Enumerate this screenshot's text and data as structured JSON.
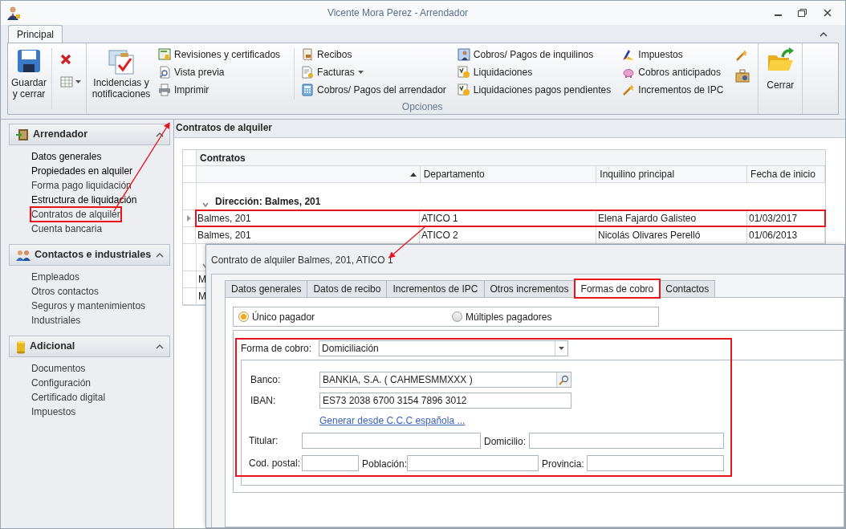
{
  "window": {
    "title": "Vicente Mora Perez - Arrendador"
  },
  "ribbon": {
    "tabs": [
      {
        "label": "Principal",
        "selected": true
      }
    ],
    "save": {
      "label": "Guardar y cerrar"
    },
    "options": {
      "title": "Opciones",
      "large": {
        "label": "Incidencias y notificaciones"
      },
      "columns": [
        [
          {
            "label": "Revisiones y certificados",
            "dropdown": false
          },
          {
            "label": "Vista previa",
            "dropdown": false
          },
          {
            "label": "Imprimir",
            "dropdown": false
          }
        ],
        [
          {
            "label": "Recibos",
            "dropdown": false
          },
          {
            "label": "Facturas",
            "dropdown": true
          },
          {
            "label": "Cobros/ Pagos del arrendador",
            "dropdown": false
          }
        ],
        [
          {
            "label": "Cobros/ Pagos de inquilinos",
            "dropdown": false
          },
          {
            "label": "Liquidaciones",
            "dropdown": false
          },
          {
            "label": "Liquidaciones pagos pendientes",
            "dropdown": false
          }
        ],
        [
          {
            "label": "Impuestos",
            "dropdown": false
          },
          {
            "label": "Cobros anticipados",
            "dropdown": false
          },
          {
            "label": "Incrementos de IPC",
            "dropdown": false
          }
        ]
      ]
    },
    "close": {
      "label": "Cerrar"
    }
  },
  "sidebar": {
    "sections": [
      {
        "title": "Arrendador",
        "expanded": true,
        "items": [
          {
            "label": "Datos generales",
            "disabled": false,
            "highlighted": false
          },
          {
            "label": "Propiedades en alquiler",
            "disabled": false,
            "highlighted": false
          },
          {
            "label": "Forma pago liquidación",
            "disabled": true,
            "highlighted": false
          },
          {
            "label": "Estructura de liquidación",
            "disabled": false,
            "highlighted": false
          },
          {
            "label": "Contratos de alquiler",
            "disabled": true,
            "highlighted": true
          },
          {
            "label": "Cuenta bancaria",
            "disabled": true,
            "highlighted": false
          }
        ]
      },
      {
        "title": "Contactos e industriales",
        "expanded": true,
        "items": [
          {
            "label": "Empleados",
            "disabled": true,
            "highlighted": false
          },
          {
            "label": "Otros contactos",
            "disabled": true,
            "highlighted": false
          },
          {
            "label": "Seguros y mantenimientos",
            "disabled": true,
            "highlighted": false
          },
          {
            "label": "Industriales",
            "disabled": true,
            "highlighted": false
          }
        ]
      },
      {
        "title": "Adicional",
        "expanded": true,
        "items": [
          {
            "label": "Documentos",
            "disabled": true,
            "highlighted": false
          },
          {
            "label": "Configuración",
            "disabled": true,
            "highlighted": false
          },
          {
            "label": "Certificado digital",
            "disabled": true,
            "highlighted": false
          },
          {
            "label": "Impuestos",
            "disabled": true,
            "highlighted": false
          }
        ]
      }
    ]
  },
  "content": {
    "title": "Contratos de alquiler",
    "grid": {
      "title": "Contratos",
      "columns": [
        {
          "sorted_ascending": true
        },
        {
          "label": "Departamento",
          "sorted_ascending": false
        },
        {
          "label": "Inquilino principal",
          "sorted_ascending": false
        },
        {
          "label": "Fecha de inicio",
          "sorted_ascending": false
        }
      ],
      "groups": [
        {
          "label": "Dirección: Balmes, 201",
          "expanded": true,
          "rows": [
            {
              "cells": [
                "Balmes, 201",
                "ATICO 1",
                "Elena Fajardo Galisteo",
                "01/03/2017"
              ],
              "current": true,
              "highlighted": true
            },
            {
              "cells": [
                "Balmes, 201",
                "ATICO 2",
                "Nicolás Olivares Perelló",
                "01/06/2013"
              ],
              "current": false,
              "highlighted": false
            }
          ]
        },
        {
          "expanded": true,
          "rows": [
            {
              "cells": [
                "M"
              ],
              "current": false,
              "highlighted": false
            },
            {
              "cells": [
                "M"
              ],
              "current": false,
              "highlighted": false
            }
          ]
        }
      ]
    }
  },
  "dialog": {
    "title": "Contrato de alquiler Balmes, 201, ATICO 1",
    "tabs": [
      {
        "label": "Datos generales",
        "selected": false,
        "highlighted": false
      },
      {
        "label": "Datos de recibo",
        "selected": false,
        "highlighted": false
      },
      {
        "label": "Incrementos de IPC",
        "selected": false,
        "highlighted": false
      },
      {
        "label": "Otros incrementos",
        "selected": false,
        "highlighted": false
      },
      {
        "label": "Formas de cobro",
        "selected": true,
        "highlighted": true
      },
      {
        "label": "Contactos",
        "selected": false,
        "highlighted": false
      }
    ],
    "payers": [
      {
        "label": "Único pagador",
        "selected": true
      },
      {
        "label": "Múltiples pagadores",
        "selected": false
      }
    ],
    "form": {
      "highlighted": true,
      "method": {
        "label": "Forma de cobro:",
        "value": "Domiciliación"
      },
      "bank": {
        "label": "Banco:",
        "value": "BANKIA, S.A. ( CAHMESMMXXX )"
      },
      "iban": {
        "label": "IBAN:",
        "value": "ES73 2038 6700 3154 7896 3012"
      },
      "link": "Generar desde C.C.C española ...",
      "holder": {
        "label": "Titular:"
      },
      "address": {
        "label": "Domicilio:"
      },
      "postal": {
        "label": "Cod. postal:"
      },
      "town": {
        "label": "Población:"
      },
      "province": {
        "label": "Provincia:"
      }
    }
  }
}
